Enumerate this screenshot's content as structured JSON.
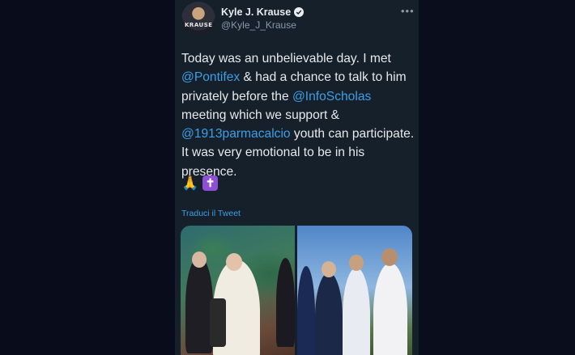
{
  "tweet": {
    "author_name": "Kyle J. Krause",
    "author_handle": "@Kyle_J_Krause",
    "avatar_text": "KRAUSE",
    "more_icon": "more-horizontal-icon",
    "verified_icon": "verified-badge-icon",
    "text_parts": {
      "p1": "Today was an unbelievable day. I met ",
      "m1": "@Pontifex",
      "p2": " & had a chance to talk to him privately before the ",
      "m2": "@InfoScholas",
      "p3": " meeting which we support & ",
      "m3": "@1913parmacalcio",
      "p4": " youth can participate. It was very emotional to be in his presence."
    },
    "emoji_1": "🙏",
    "emoji_2": "✝",
    "translate_label": "Traduci il Tweet"
  },
  "colors": {
    "card_bg": "#15202b",
    "link": "#3d9fe6",
    "text": "#e7e9ea",
    "muted": "#8b98a5"
  }
}
